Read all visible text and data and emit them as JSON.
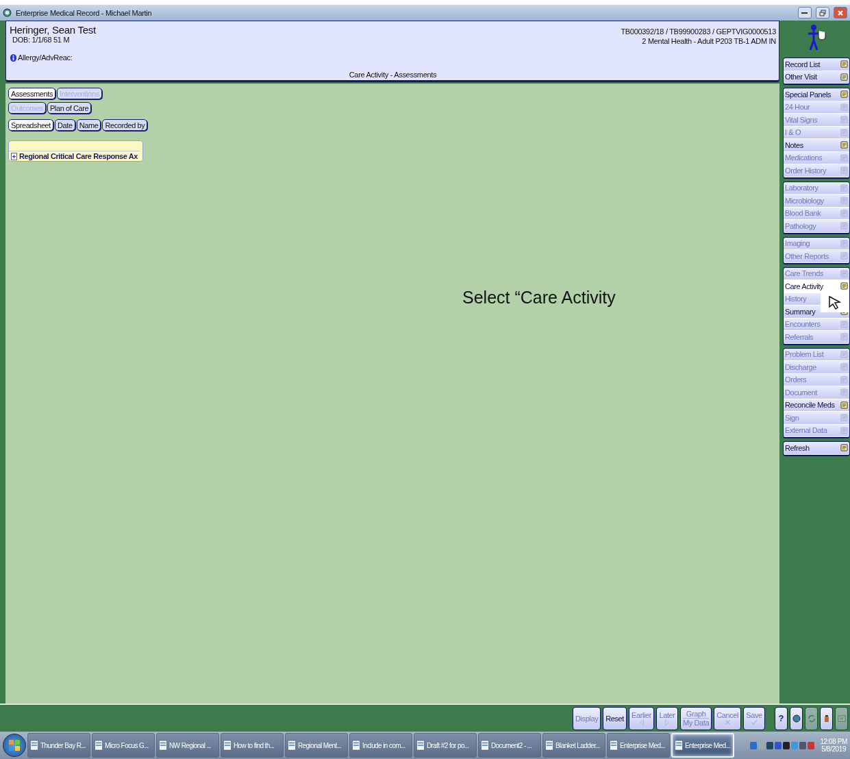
{
  "window": {
    "title": "Enterprise Medical Record - Michael Martin"
  },
  "header": {
    "patient_name": "Heringer, Sean Test",
    "dob": "DOB: 1/1/68 51 M",
    "allergy": "Allergy/AdvReac:",
    "ids": "TB000392/18 / TB99900283 / GEPTVIG0000513",
    "location": "2 Mental Health - Adult P203 TB-1  ADM IN",
    "view_title": "Care Activity - Assessments"
  },
  "view_buttons": [
    [
      {
        "label": "Assessments",
        "selected": true,
        "disabled": false
      },
      {
        "label": "Interventions",
        "selected": false,
        "disabled": true
      }
    ],
    [
      {
        "label": "Outcomes",
        "selected": false,
        "disabled": true
      },
      {
        "label": "Plan of Care",
        "selected": false,
        "disabled": false
      }
    ],
    [
      {
        "label": "Spreadsheet",
        "selected": true,
        "disabled": false
      },
      {
        "label": "Date",
        "selected": false,
        "disabled": false
      },
      {
        "label": "Name",
        "selected": false,
        "disabled": false
      },
      {
        "label": "Recorded by",
        "selected": false,
        "disabled": false
      }
    ]
  ],
  "tree": {
    "items": [
      {
        "label": "Regional Critical Care Response Ax",
        "expanded": false
      }
    ]
  },
  "annotation": "Select “Care Activity",
  "sidebar": {
    "groups": [
      [
        {
          "label": "Record List",
          "disabled": false,
          "selected": false
        },
        {
          "label": "Other Visit",
          "disabled": false,
          "selected": false
        }
      ],
      [
        {
          "label": "Special Panels",
          "disabled": false,
          "selected": false
        },
        {
          "label": "24 Hour",
          "disabled": true,
          "selected": false
        },
        {
          "label": "Vital Signs",
          "disabled": true,
          "selected": false
        },
        {
          "label": "I & O",
          "disabled": true,
          "selected": false
        },
        {
          "label": "Notes",
          "disabled": false,
          "selected": false
        },
        {
          "label": "Medications",
          "disabled": true,
          "selected": false
        },
        {
          "label": "Order History",
          "disabled": true,
          "selected": false
        }
      ],
      [
        {
          "label": "Laboratory",
          "disabled": true,
          "selected": false
        },
        {
          "label": "Microbiology",
          "disabled": true,
          "selected": false
        },
        {
          "label": "Blood Bank",
          "disabled": true,
          "selected": false
        },
        {
          "label": "Pathology",
          "disabled": true,
          "selected": false
        }
      ],
      [
        {
          "label": "Imaging",
          "disabled": true,
          "selected": false
        },
        {
          "label": "Other Reports",
          "disabled": true,
          "selected": false
        }
      ],
      [
        {
          "label": "Care Trends",
          "disabled": true,
          "selected": false
        },
        {
          "label": "Care Activity",
          "disabled": false,
          "selected": true
        },
        {
          "label": "History",
          "disabled": true,
          "selected": false
        },
        {
          "label": "Summary",
          "disabled": false,
          "selected": false
        },
        {
          "label": "Encounters",
          "disabled": true,
          "selected": false
        },
        {
          "label": "Referrals",
          "disabled": true,
          "selected": false
        }
      ],
      [
        {
          "label": "Problem List",
          "disabled": true,
          "selected": false
        },
        {
          "label": "Discharge",
          "disabled": true,
          "selected": false
        },
        {
          "label": "Orders",
          "disabled": true,
          "selected": false
        },
        {
          "label": "Document",
          "disabled": true,
          "selected": false
        },
        {
          "label": "Reconcile Meds",
          "disabled": false,
          "selected": false
        },
        {
          "label": "Sign",
          "disabled": true,
          "selected": false
        },
        {
          "label": "External Data",
          "disabled": true,
          "selected": false
        }
      ],
      [
        {
          "label": "Refresh",
          "disabled": false,
          "selected": false
        }
      ]
    ]
  },
  "toolbar": {
    "buttons": [
      {
        "kind": "text",
        "label": "Display",
        "disabled": true
      },
      {
        "kind": "text",
        "label": "Reset",
        "disabled": false
      },
      {
        "kind": "arrow_left",
        "label": "Earlier",
        "disabled": true
      },
      {
        "kind": "arrow_right",
        "label": "Later",
        "disabled": true
      },
      {
        "kind": "split",
        "label": "Graph",
        "sublabel": "My Data",
        "disabled": true
      },
      {
        "kind": "cross",
        "label": "Cancel",
        "disabled": true
      },
      {
        "kind": "check",
        "label": "Save",
        "disabled": true
      }
    ],
    "icon_buttons": [
      {
        "kind": "help",
        "label": "?",
        "disabled": false
      },
      {
        "kind": "globe",
        "disabled": false
      },
      {
        "kind": "refresh",
        "disabled": true
      },
      {
        "kind": "bottle",
        "disabled": false
      },
      {
        "kind": "note",
        "disabled": true
      }
    ]
  },
  "taskbar": {
    "items": [
      {
        "label": "Thunder Bay R...",
        "selected": false
      },
      {
        "label": "Micro Focus G...",
        "selected": false
      },
      {
        "label": "NW Regional ...",
        "selected": false
      },
      {
        "label": "How to find th...",
        "selected": false
      },
      {
        "label": "Regional Ment...",
        "selected": false
      },
      {
        "label": "Include in com...",
        "selected": false
      },
      {
        "label": "Draft #2 for po...",
        "selected": false
      },
      {
        "label": "Document2 - ...",
        "selected": false
      },
      {
        "label": "Blanket Ladder...",
        "selected": false
      },
      {
        "label": "Enterprise Med...",
        "selected": false
      },
      {
        "label": "Enterprise Med...",
        "selected": true
      }
    ],
    "time": "12:08 PM",
    "date": "5/8/2019"
  }
}
